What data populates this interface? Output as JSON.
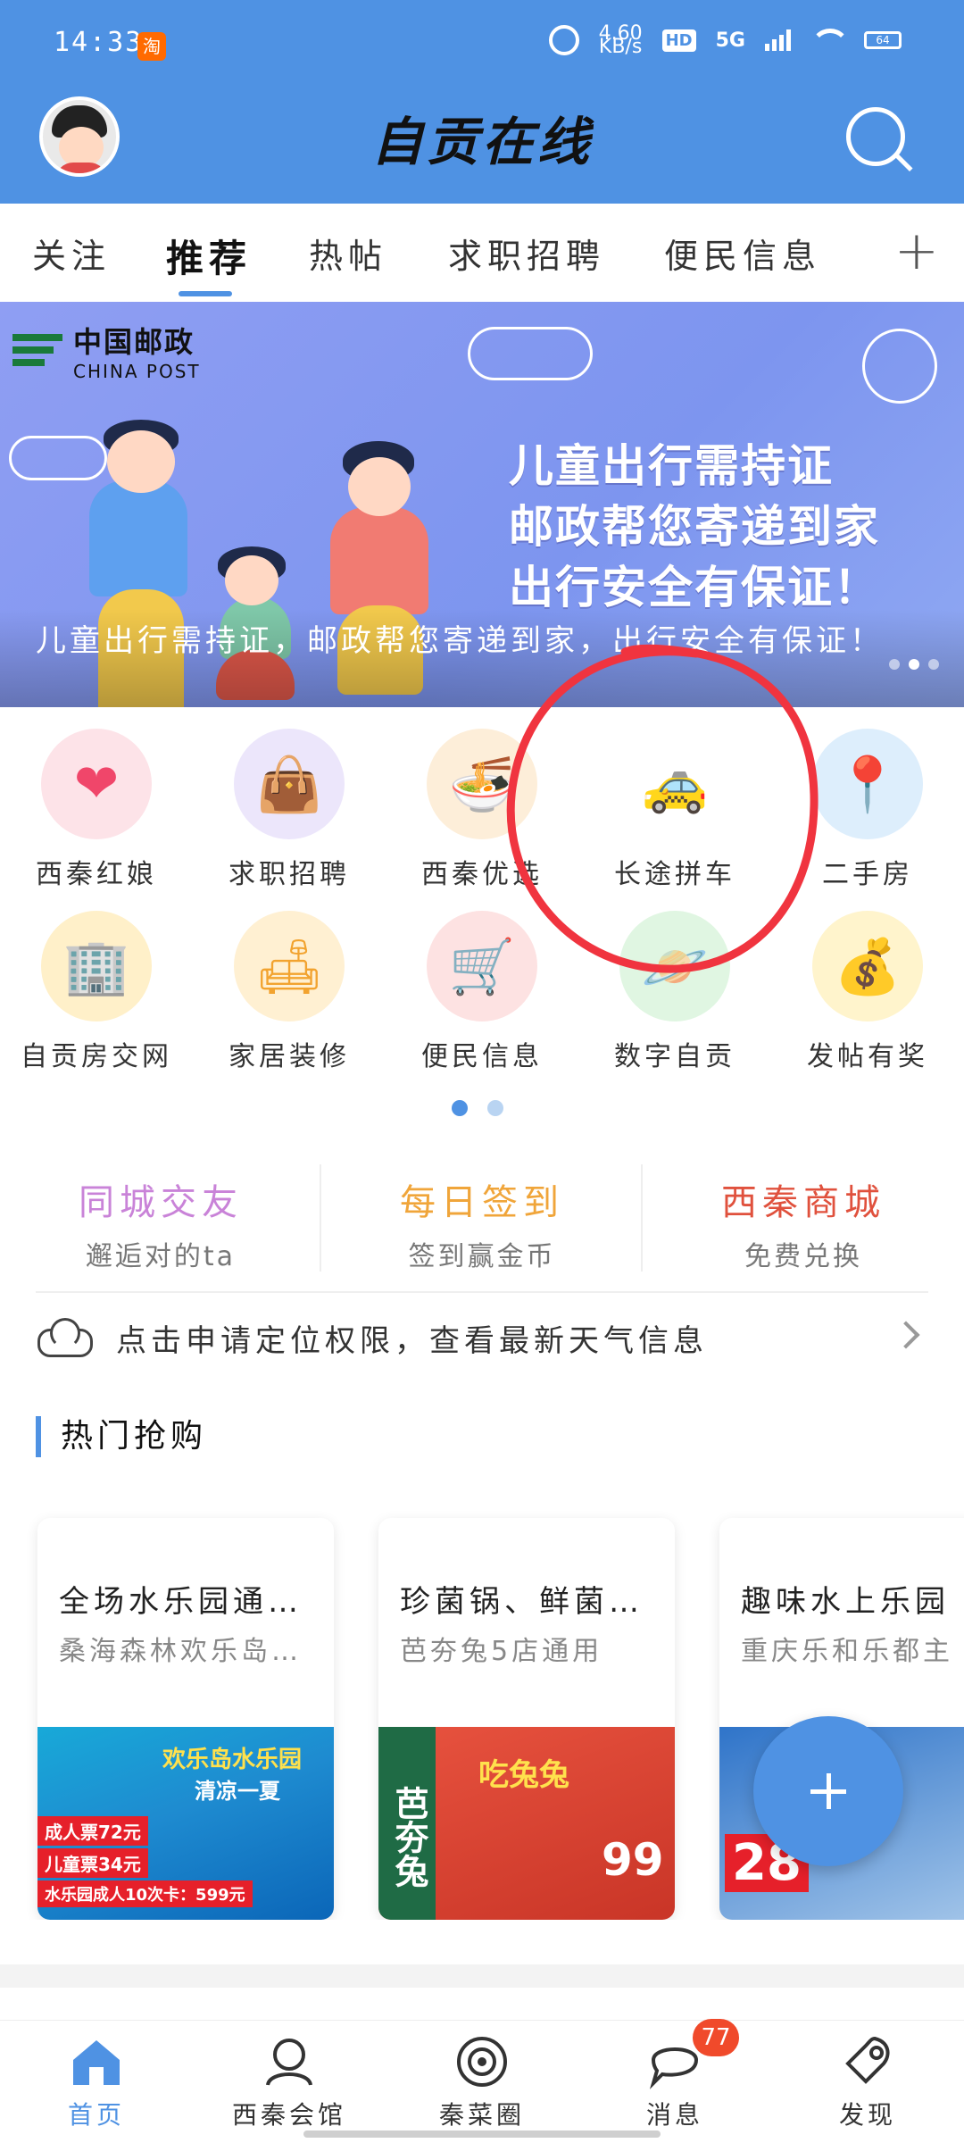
{
  "status_bar": {
    "time": "14:33",
    "network_speed": "4.60\nKB/s",
    "hd": "HD",
    "signal": "5G",
    "battery": "64"
  },
  "header": {
    "title": "自贡在线"
  },
  "tabs": [
    "关注",
    "推荐",
    "热帖",
    "求职招聘",
    "便民信息"
  ],
  "active_tab": "推荐",
  "banner": {
    "logo_cn": "中国邮政",
    "logo_en": "CHINA POST",
    "headline": [
      "儿童出行需持证",
      "邮政帮您寄递到家",
      "出行安全有保证！"
    ],
    "caption": "儿童出行需持证，邮政帮您寄递到家，出行安全有保证！"
  },
  "grid": [
    {
      "label": "西秦红娘",
      "icon": "heart-icon",
      "bg": "#fde3e8",
      "fg": "#f0466a"
    },
    {
      "label": "求职招聘",
      "icon": "bag-icon",
      "bg": "#ece6fb",
      "fg": "#8b5ef0"
    },
    {
      "label": "西秦优选",
      "icon": "bowl-icon",
      "bg": "#fdeed9",
      "fg": "#f39a27"
    },
    {
      "label": "长途拼车",
      "icon": "car-icon",
      "bg": "#ffffff",
      "fg": "#4f9df0"
    },
    {
      "label": "二手房",
      "icon": "location-pin-icon",
      "bg": "#ddeefc",
      "fg": "#2f8fe8"
    },
    {
      "label": "自贡房交网",
      "icon": "building-icon",
      "bg": "#fff0c9",
      "fg": "#f1a81f"
    },
    {
      "label": "家居装修",
      "icon": "sofa-icon",
      "bg": "#fff0d2",
      "fg": "#f2a32f"
    },
    {
      "label": "便民信息",
      "icon": "stroller-icon",
      "bg": "#fde2e2",
      "fg": "#ef5a5a"
    },
    {
      "label": "数字自贡",
      "icon": "planet-icon",
      "bg": "#e0f6e2",
      "fg": "#36c26b"
    },
    {
      "label": "发帖有奖",
      "icon": "money-bag-icon",
      "bg": "#fff4cc",
      "fg": "#e6492d"
    }
  ],
  "quick": [
    {
      "title": "同城交友",
      "sub": "邂逅对的ta",
      "color": "#c983d8"
    },
    {
      "title": "每日签到",
      "sub": "签到赢金币",
      "color": "#f0a53a"
    },
    {
      "title": "西秦商城",
      "sub": "免费兑换",
      "color": "#e0513d"
    }
  ],
  "weather": {
    "text": "点击申请定位权限，查看最新天气信息"
  },
  "section": {
    "title": "热门抢购"
  },
  "deals": [
    {
      "name": "全场水乐园通…",
      "sub": "桑海森林欢乐岛…",
      "img_title": "欢乐岛水乐园",
      "img_title2": "清凉一夏",
      "prices": [
        "成人票72元",
        "儿童票34元",
        "水乐园成人10次卡：599元"
      ]
    },
    {
      "name": "珍菌锅、鲜菌…",
      "sub": "芭夯兔5店通用",
      "img_brand": "芭夯兔",
      "img_title": "吃兔兔",
      "img_price": "99"
    },
    {
      "name": "趣味水上乐园",
      "sub": "重庆乐和乐都主",
      "img_price": "28"
    }
  ],
  "bottom_nav": [
    {
      "label": "首页",
      "icon": "home-icon"
    },
    {
      "label": "西秦会馆",
      "icon": "people-icon"
    },
    {
      "label": "秦菜圈",
      "icon": "orbit-icon"
    },
    {
      "label": "消息",
      "icon": "chat-icon",
      "badge": "77"
    },
    {
      "label": "发现",
      "icon": "rocket-icon"
    }
  ],
  "colors": {
    "primary": "#4f92e3",
    "annotation": "#f0343f"
  }
}
